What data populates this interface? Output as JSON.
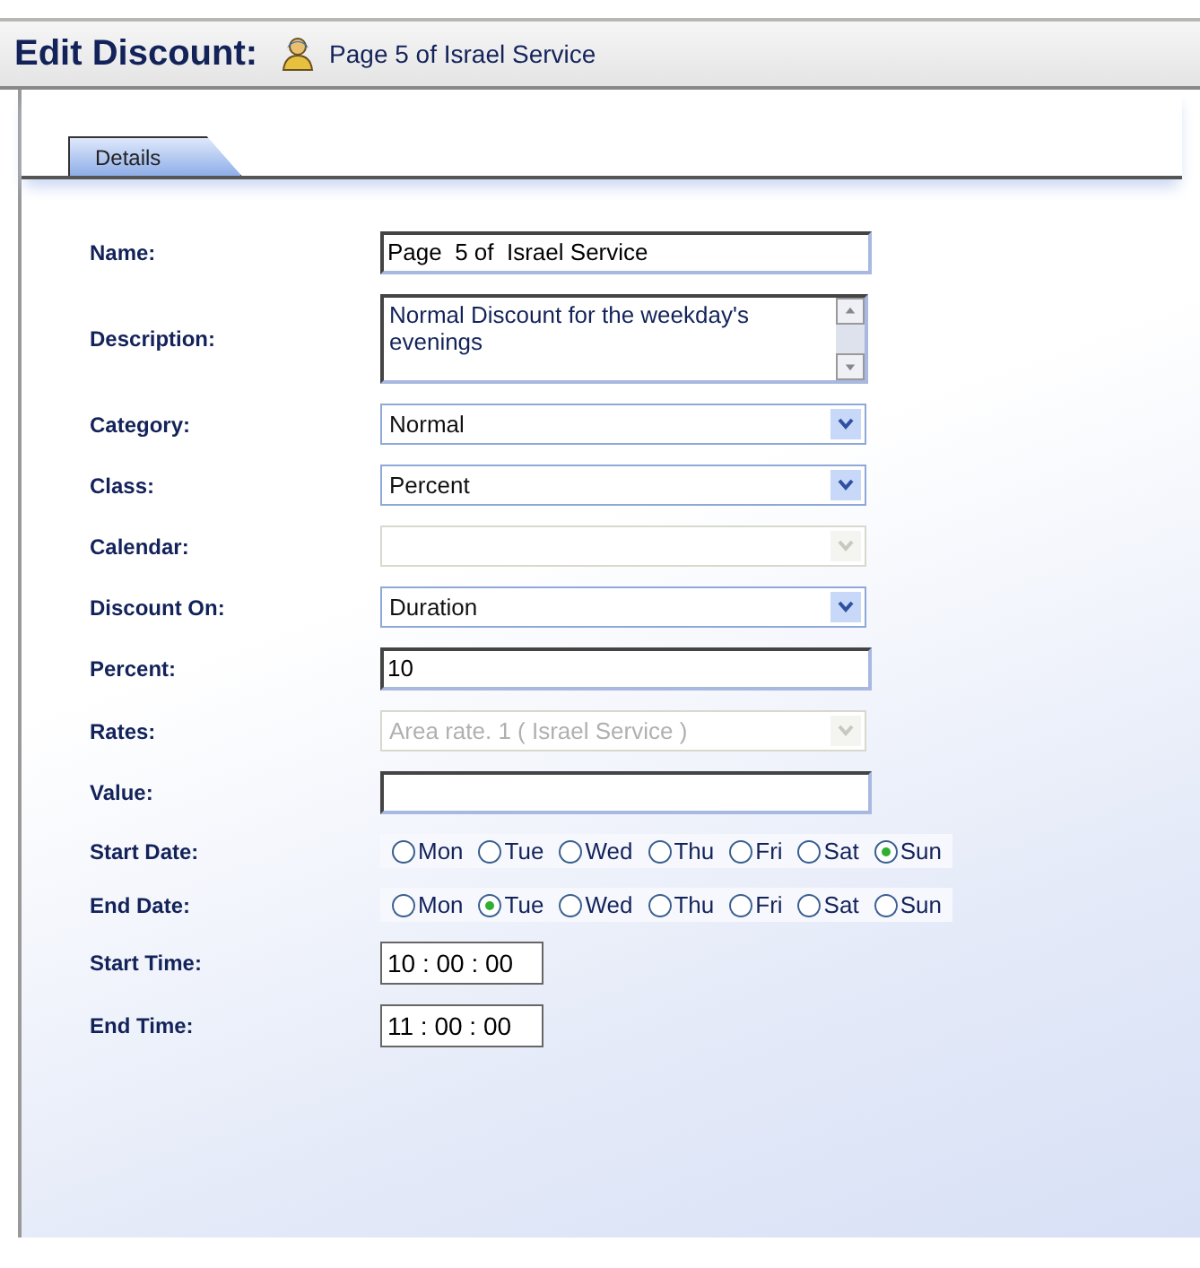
{
  "header": {
    "title": "Edit Discount:",
    "subtitle": "Page 5 of Israel Service"
  },
  "tabs": [
    {
      "label": "Details",
      "selected": true
    }
  ],
  "fields": [
    {
      "kind": "text",
      "label": "Name:",
      "value": "Page  5 of  Israel Service"
    },
    {
      "kind": "textarea",
      "label": "Description:",
      "value": "Normal Discount for the weekday's evenings"
    },
    {
      "kind": "select",
      "label": "Category:",
      "value": "Normal",
      "disabled": false
    },
    {
      "kind": "select",
      "label": "Class:",
      "value": "Percent",
      "disabled": false
    },
    {
      "kind": "select",
      "label": "Calendar:",
      "disabled": true
    },
    {
      "kind": "select",
      "label": "Discount On:",
      "value": "Duration",
      "disabled": false
    },
    {
      "kind": "text",
      "label": "Percent:",
      "value": "10"
    },
    {
      "kind": "select",
      "label": "Rates:",
      "value": "Area rate. 1 ( Israel Service )",
      "disabled": true
    },
    {
      "kind": "text",
      "label": "Value:"
    },
    {
      "kind": "radio",
      "label": "Start Date:",
      "options": [
        {
          "label": "Mon",
          "selected": false
        },
        {
          "label": "Tue",
          "selected": false
        },
        {
          "label": "Wed",
          "selected": false
        },
        {
          "label": "Thu",
          "selected": false
        },
        {
          "label": "Fri",
          "selected": false
        },
        {
          "label": "Sat",
          "selected": false
        },
        {
          "label": "Sun",
          "selected": true
        }
      ]
    },
    {
      "kind": "radio",
      "label": "End Date:",
      "options": [
        {
          "label": "Mon",
          "selected": false
        },
        {
          "label": "Tue",
          "selected": true
        },
        {
          "label": "Wed",
          "selected": false
        },
        {
          "label": "Thu",
          "selected": false
        },
        {
          "label": "Fri",
          "selected": false
        },
        {
          "label": "Sat",
          "selected": false
        },
        {
          "label": "Sun",
          "selected": false
        }
      ]
    },
    {
      "kind": "time",
      "label": "Start Time:",
      "value": "10 : 00 : 00"
    },
    {
      "kind": "time",
      "label": "End Time:",
      "value": "11 : 00 : 00"
    }
  ]
}
